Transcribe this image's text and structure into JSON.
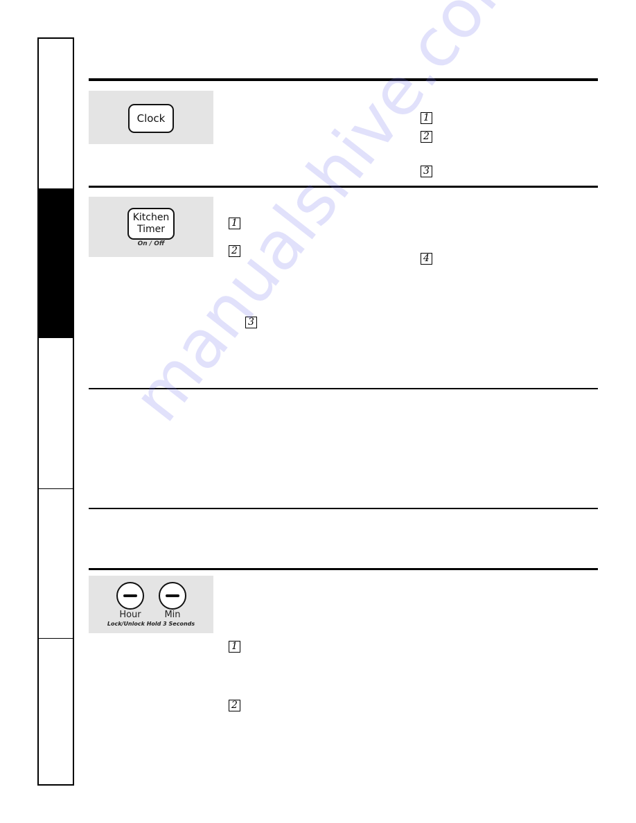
{
  "side_tabs": [
    {
      "label": "",
      "active": false
    },
    {
      "label": "",
      "active": true
    },
    {
      "label": "",
      "active": false
    },
    {
      "label": "",
      "active": false
    },
    {
      "label": "",
      "active": false
    }
  ],
  "sections": {
    "clock": {
      "key_label": "Clock",
      "steps": [
        "1",
        "2",
        "3"
      ]
    },
    "kitchen_timer": {
      "key_label_line1": "Kitchen",
      "key_label_line2": "Timer",
      "sub_label": "On / Off",
      "steps": [
        "1",
        "2",
        "3",
        "4"
      ]
    },
    "hour_min": {
      "hour_label": "Hour",
      "min_label": "Min",
      "sub_label": "Lock/Unlock Hold 3 Seconds",
      "steps": [
        "1",
        "2"
      ]
    }
  },
  "watermark": "manualshive.com",
  "colors": {
    "panel_background": "#e4e4e4",
    "rule": "#000000",
    "active_tab": "#000000",
    "watermark": "#7878eb"
  }
}
